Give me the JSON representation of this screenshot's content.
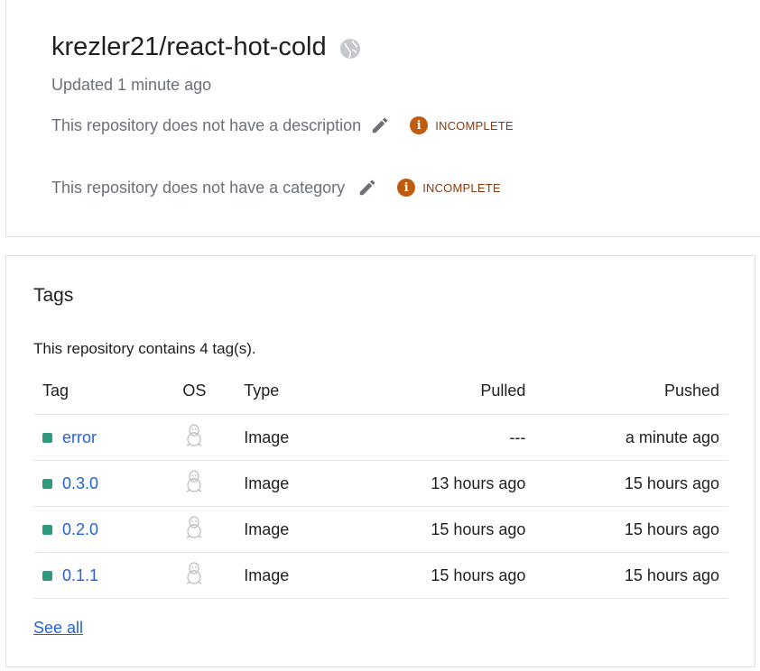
{
  "repo": {
    "title": "krezler21/react-hot-cold",
    "updated": "Updated 1 minute ago",
    "visibility_icon": "globe-icon",
    "description_text": "This repository does not have a description",
    "description_status": "INCOMPLETE",
    "category_text": "This repository does not have a category",
    "category_status": "INCOMPLETE",
    "status_color": "#c15a0d"
  },
  "tags": {
    "heading": "Tags",
    "count_text": "This repository contains 4 tag(s).",
    "columns": {
      "tag": "Tag",
      "os": "OS",
      "type": "Type",
      "pulled": "Pulled",
      "pushed": "Pushed"
    },
    "rows": [
      {
        "tag": "error",
        "os_icon": "linux-icon",
        "type": "Image",
        "pulled": "---",
        "pushed": "a minute ago"
      },
      {
        "tag": "0.3.0",
        "os_icon": "linux-icon",
        "type": "Image",
        "pulled": "13 hours ago",
        "pushed": "15 hours ago"
      },
      {
        "tag": "0.2.0",
        "os_icon": "linux-icon",
        "type": "Image",
        "pulled": "15 hours ago",
        "pushed": "15 hours ago"
      },
      {
        "tag": "0.1.1",
        "os_icon": "linux-icon",
        "type": "Image",
        "pulled": "15 hours ago",
        "pushed": "15 hours ago"
      }
    ],
    "see_all": "See all",
    "link_color": "#2463d1",
    "status_square_color": "#2f9a7d"
  }
}
